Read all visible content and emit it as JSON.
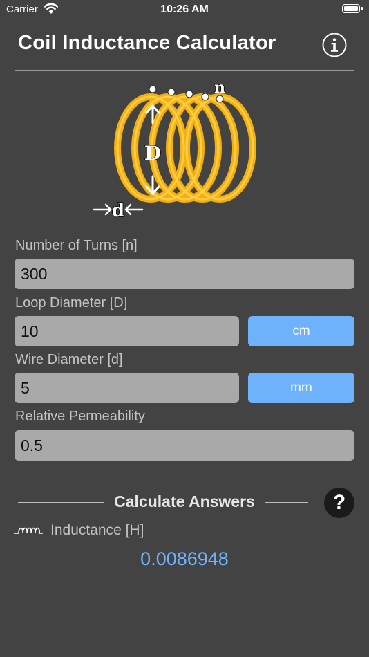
{
  "status_bar": {
    "carrier": "Carrier",
    "time": "10:26 AM"
  },
  "header": {
    "title": "Coil Inductance Calculator"
  },
  "diagram": {
    "label_turns": "n",
    "label_loop_diameter": "D",
    "label_wire_diameter": "d"
  },
  "fields": {
    "turns": {
      "label": "Number of Turns [n]",
      "value": "300"
    },
    "loop_diameter": {
      "label": "Loop Diameter [D]",
      "value": "10",
      "unit": "cm"
    },
    "wire_diameter": {
      "label": "Wire Diameter [d]",
      "value": "5",
      "unit": "mm"
    },
    "permeability": {
      "label": "Relative Permeability",
      "value": "0.5"
    }
  },
  "calculate": {
    "label": "Calculate Answers",
    "help": "?"
  },
  "result": {
    "label": "Inductance [H]",
    "value": "0.0086948"
  },
  "colors": {
    "background": "#434343",
    "input_bg": "#a9a9a9",
    "accent": "#6eb2fb",
    "coil": "#f5b00d"
  },
  "icons": [
    "wifi-icon",
    "battery-icon",
    "info-icon",
    "help-icon",
    "inductor-icon"
  ]
}
